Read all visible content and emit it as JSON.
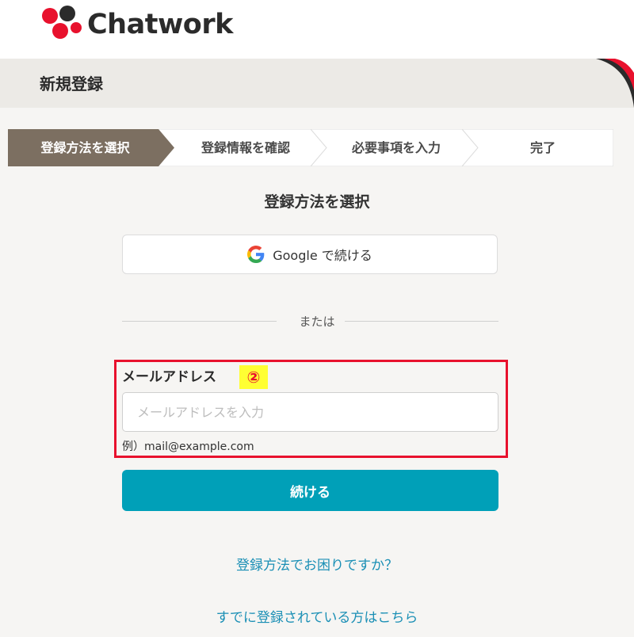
{
  "app": {
    "logo_text": "Chatwork",
    "colors": {
      "accent": "#00a0b8",
      "brand_red": "#e8112d",
      "link": "#1a8fb5"
    }
  },
  "header": {
    "title": "新規登録"
  },
  "steps": [
    {
      "label": "登録方法を選択",
      "active": true
    },
    {
      "label": "登録情報を確認",
      "active": false
    },
    {
      "label": "必要事項を入力",
      "active": false
    },
    {
      "label": "完了",
      "active": false
    }
  ],
  "main": {
    "title": "登録方法を選択",
    "google_button": {
      "icon": "google-icon",
      "label": "Google で続ける"
    },
    "or_text": "または",
    "email": {
      "label": "メールアドレス",
      "annotation": "②",
      "placeholder": "メールアドレスを入力",
      "value": "",
      "hint": "例）mail@example.com"
    },
    "continue_label": "続ける",
    "help_link": "登録方法でお困りですか？",
    "login_link": "すでに登録されている方はこちら"
  }
}
